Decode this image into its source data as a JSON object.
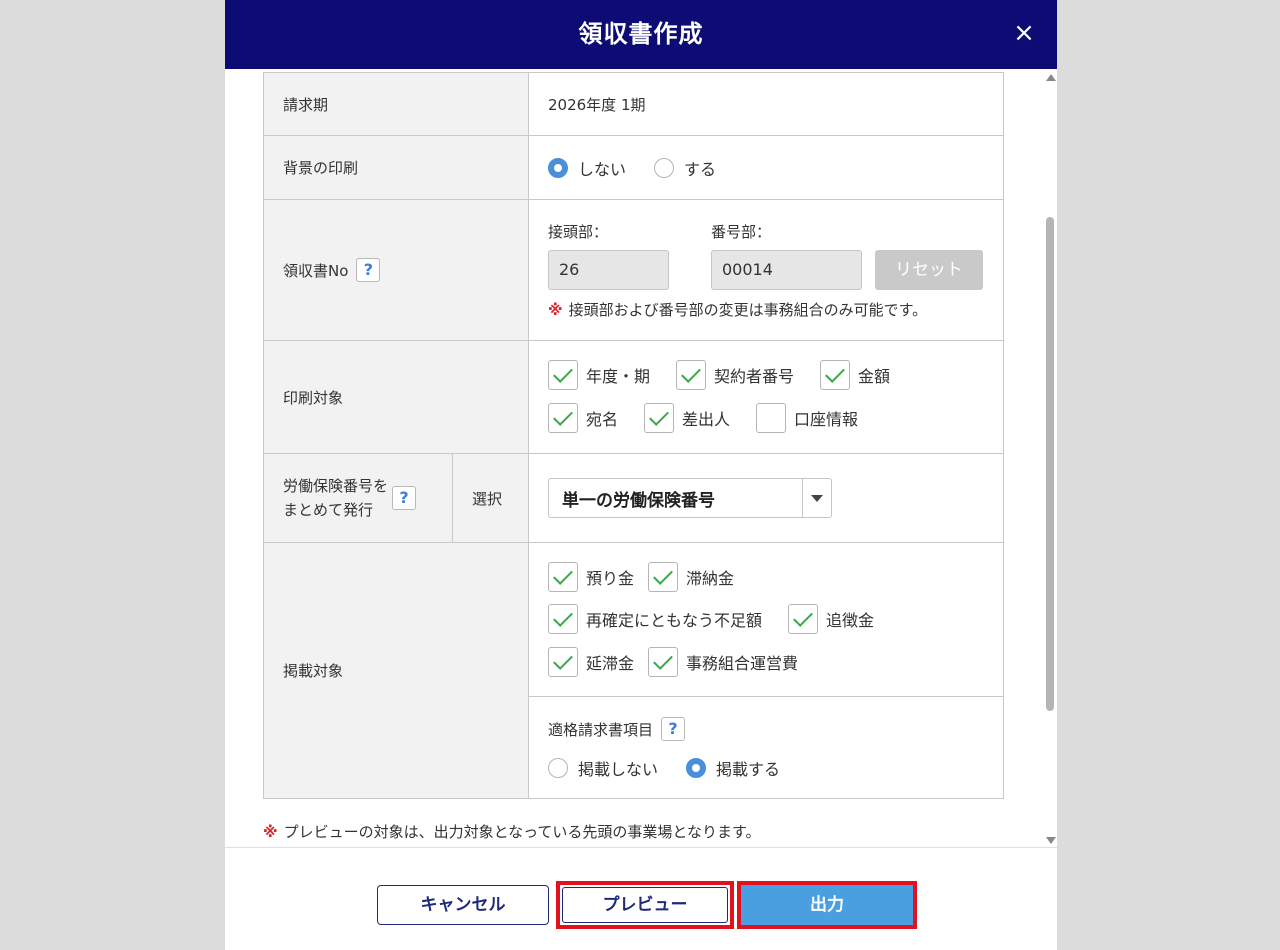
{
  "dialog": {
    "title": "領収書作成",
    "close_label": "×"
  },
  "rows": {
    "billing_period": {
      "label": "請求期",
      "value": "2026年度 1期"
    },
    "background_print": {
      "label": "背景の印刷",
      "options": [
        "しない",
        "する"
      ],
      "selected": "しない"
    },
    "receipt_no": {
      "label": "領収書No",
      "help": "?",
      "prefix_label": "接頭部：",
      "prefix_value": "26",
      "number_label": "番号部：",
      "number_value": "00014",
      "reset_label": "リセット",
      "note_mark": "※",
      "note": "接頭部および番号部の変更は事務組合のみ可能です。"
    },
    "print_targets": {
      "label": "印刷対象",
      "items": [
        {
          "label": "年度・期",
          "checked": true
        },
        {
          "label": "契約者番号",
          "checked": true
        },
        {
          "label": "金額",
          "checked": true
        },
        {
          "label": "宛名",
          "checked": true
        },
        {
          "label": "差出人",
          "checked": true
        },
        {
          "label": "口座情報",
          "checked": false
        }
      ]
    },
    "labor_insurance": {
      "label_line1": "労働保険番号を",
      "label_line2": "まとめて発行",
      "help": "?",
      "sub_label": "選択",
      "select_value": "単一の労働保険番号"
    },
    "listing_targets": {
      "label": "掲載対象",
      "items": [
        {
          "label": "預り金",
          "checked": true
        },
        {
          "label": "滞納金",
          "checked": true
        },
        {
          "label": "再確定にともなう不足額",
          "checked": true
        },
        {
          "label": "追徴金",
          "checked": true
        },
        {
          "label": "延滞金",
          "checked": true
        },
        {
          "label": "事務組合運営費",
          "checked": true
        }
      ],
      "invoice_label": "適格請求書項目",
      "invoice_help": "?",
      "invoice_options": [
        "掲載しない",
        "掲載する"
      ],
      "invoice_selected": "掲載する"
    }
  },
  "preview_note": {
    "mark": "※",
    "text": "プレビューの対象は、出力対象となっている先頭の事業場となります。"
  },
  "footer": {
    "cancel_label": "キャンセル",
    "preview_label": "プレビュー",
    "output_label": "出力"
  }
}
